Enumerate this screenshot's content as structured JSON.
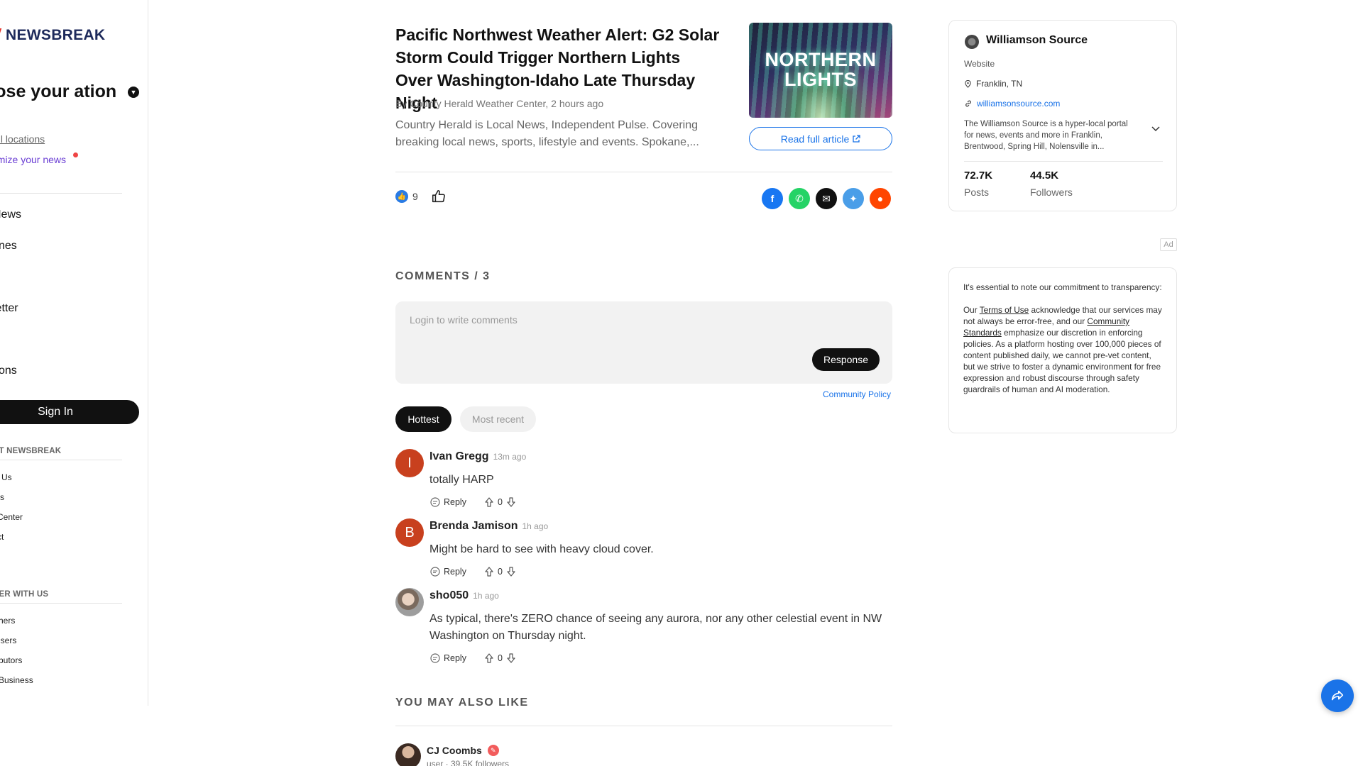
{
  "sidebar": {
    "logo_text": "NEWSBREAK",
    "choose_title": "oose your ation",
    "all_locations": "all locations",
    "customize": "omize your news",
    "nav": [
      "l News",
      "dlines",
      "s",
      "sletter",
      "cs",
      "ctions"
    ],
    "sign_in": "Sign In",
    "about_title": "UT NEWSBREAK",
    "about_links": [
      "Us",
      "rs",
      "Center",
      "ct"
    ],
    "partner_title": "NER WITH US",
    "partner_links": [
      "hers",
      "isers",
      "butors",
      "Business"
    ]
  },
  "article": {
    "title": "Pacific Northwest Weather Alert: G2 Solar Storm Could Trigger Northern Lights Over Washington-Idaho Late Thursday Night",
    "byline": "By County Herald Weather Center, 2 hours ago",
    "snippet": "Country Herald is Local News, Independent Pulse. Covering breaking local news, sports, lifestyle and events. Spokane,...",
    "thumbnail_text": "NORTHERN LIGHTS",
    "read_full": "Read full article",
    "like_count": "9"
  },
  "share": {
    "icons": [
      "facebook-icon",
      "whatsapp-icon",
      "email-icon",
      "twitter-icon",
      "reddit-icon"
    ],
    "colors": [
      "#1877f2",
      "#25d366",
      "#111111",
      "#4a9ee8",
      "#ff4500"
    ]
  },
  "comments": {
    "header": "COMMENTS / 3",
    "placeholder": "Login to write comments",
    "response_btn": "Response",
    "policy": "Community Policy",
    "tabs": [
      "Hottest",
      "Most recent"
    ],
    "list": [
      {
        "initial": "I",
        "avatar_color": "#c8401e",
        "name": "Ivan Gregg",
        "time": "13m ago",
        "text": "totally HARP",
        "reply": "Reply",
        "votes": "0"
      },
      {
        "initial": "B",
        "avatar_color": "#c8401e",
        "name": "Brenda Jamison",
        "time": "1h ago",
        "text": "Might be hard to see with heavy cloud cover.",
        "reply": "Reply",
        "votes": "0"
      },
      {
        "initial": "",
        "avatar_color": "#8a8a8a",
        "name": "sho050",
        "time": "1h ago",
        "text": "As typical, there's ZERO chance of seeing any aurora, nor any other celestial event in NW Washington on Thursday night.",
        "reply": "Reply",
        "votes": "0"
      }
    ]
  },
  "also_like": {
    "header": "YOU MAY ALSO LIKE",
    "name": "CJ Coombs",
    "meta": "user · 39.5K followers"
  },
  "source": {
    "name": "Williamson Source",
    "type": "Website",
    "location": "Franklin, TN",
    "url": "williamsonsource.com",
    "description": "The Williamson Source is a hyper-local portal for news, events and more in Franklin, Brentwood, Spring Hill, Nolensville in...",
    "posts_num": "72.7K",
    "posts_lbl": "Posts",
    "followers_num": "44.5K",
    "followers_lbl": "Followers"
  },
  "ad": {
    "tag": "Ad",
    "p1": "It's essential to note our commitment to transparency:",
    "p2_a": "Our ",
    "terms": "Terms of Use",
    "p2_b": " acknowledge that our services may not always be error-free, and our ",
    "standards": "Community Standards",
    "p2_c": " emphasize our discretion in enforcing policies. As a platform hosting over 100,000 pieces of content published daily, we cannot pre-vet content, but we strive to foster a dynamic environment for free expression and robust discourse through safety guardrails of human and AI moderation."
  }
}
